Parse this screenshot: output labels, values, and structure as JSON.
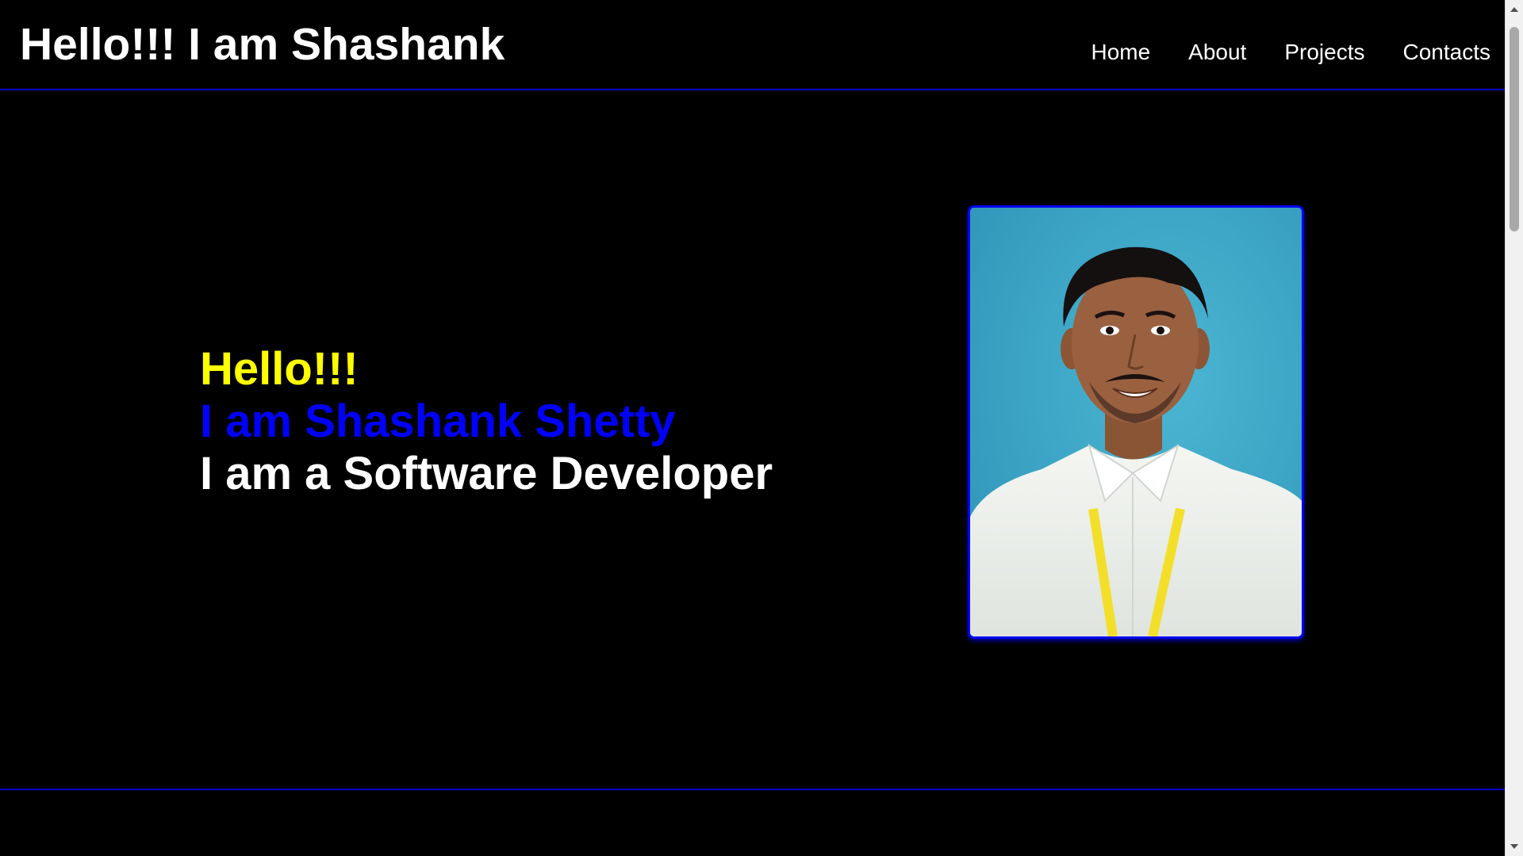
{
  "header": {
    "title": "Hello!!! I am Shashank",
    "nav": [
      {
        "label": "Home"
      },
      {
        "label": "About"
      },
      {
        "label": "Projects"
      },
      {
        "label": "Contacts"
      }
    ]
  },
  "hero": {
    "greeting": "Hello!!!",
    "name_line": "I am Shashank Shetty",
    "role_line": "I am a Software Developer",
    "photo_alt": "profile-photo"
  },
  "colors": {
    "background": "#000000",
    "accent_blue": "#0000ff",
    "greeting_yellow": "#ffff00",
    "text_white": "#ffffff",
    "photo_background": "#3fa8c8"
  },
  "icons": {
    "scroll_up": "triangle-up-icon",
    "scroll_down": "triangle-down-icon"
  }
}
